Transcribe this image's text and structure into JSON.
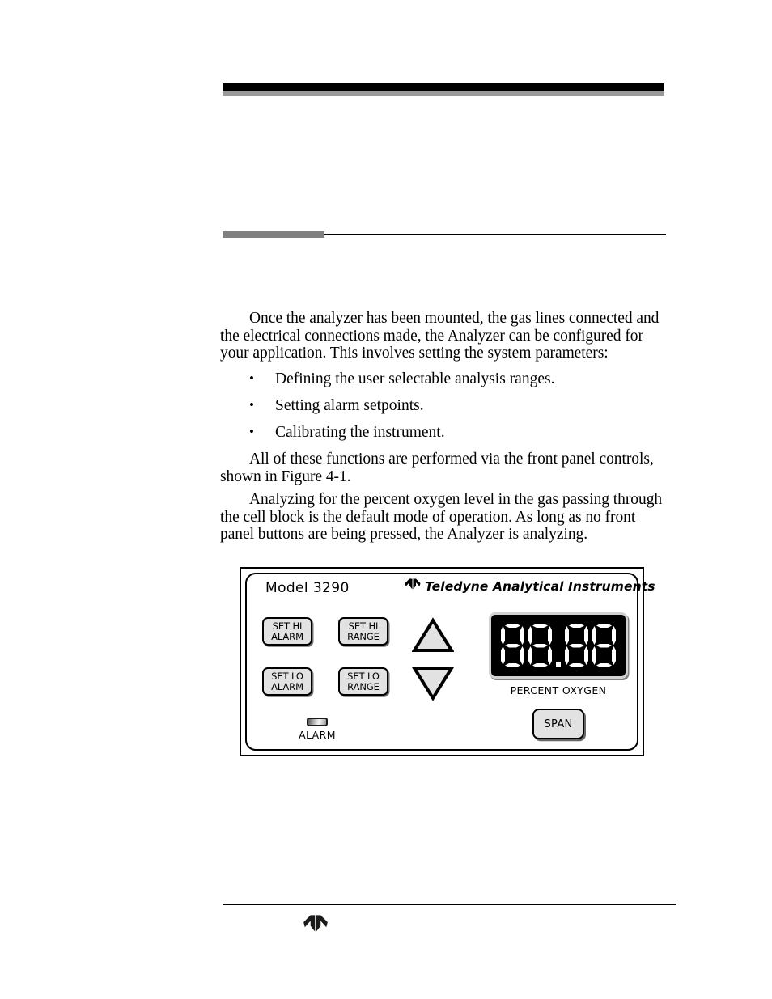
{
  "document": {
    "header": {
      "rule_black_color": "#000000",
      "rule_gray_color": "#9a9a9a",
      "section_rule_gray_color": "#808080"
    },
    "body": {
      "paragraphs": [
        "Once the analyzer has been mounted, the gas lines connected and the electrical connections made, the Analyzer can be configured for your application. This involves setting the system parameters:",
        "All of these functions are performed via the front panel controls, shown in Figure 4-1.",
        "Analyzing for the percent oxygen level in the gas passing through the cell block is the default mode of operation. As long as no front panel buttons are being pressed, the Analyzer is analyzing."
      ],
      "bullets": [
        "Defining the user selectable analysis ranges.",
        "Setting alarm setpoints.",
        "Calibrating the instrument."
      ],
      "bullet_glyph": "•"
    },
    "figure": {
      "panel": {
        "model_label": "Model 3290",
        "brand_text": "Teledyne Analytical Instruments",
        "brand_mark": "teledyne-bird-logo",
        "buttons": [
          {
            "name": "set-hi-alarm",
            "line1": "SET HI",
            "line2": "ALARM"
          },
          {
            "name": "set-hi-range",
            "line1": "SET HI",
            "line2": "RANGE"
          },
          {
            "name": "set-lo-alarm",
            "line1": "SET LO",
            "line2": "ALARM"
          },
          {
            "name": "set-lo-range",
            "line1": "SET LO",
            "line2": "RANGE"
          }
        ],
        "arrow_up": "up-arrow-icon",
        "arrow_down": "down-arrow-icon",
        "display": {
          "value": "88.88",
          "digits": [
            "8",
            "8",
            "8",
            "8"
          ],
          "decimal_after_digit": 2,
          "caption": "PERCENT OXYGEN",
          "segment_color": "#ffffff",
          "background_color": "#000000"
        },
        "span_button_label": "SPAN",
        "alarm_label": "ALARM",
        "alarm_led": "alarm-indicator-led"
      }
    },
    "footer": {
      "logo": "teledyne-bird-logo"
    }
  }
}
